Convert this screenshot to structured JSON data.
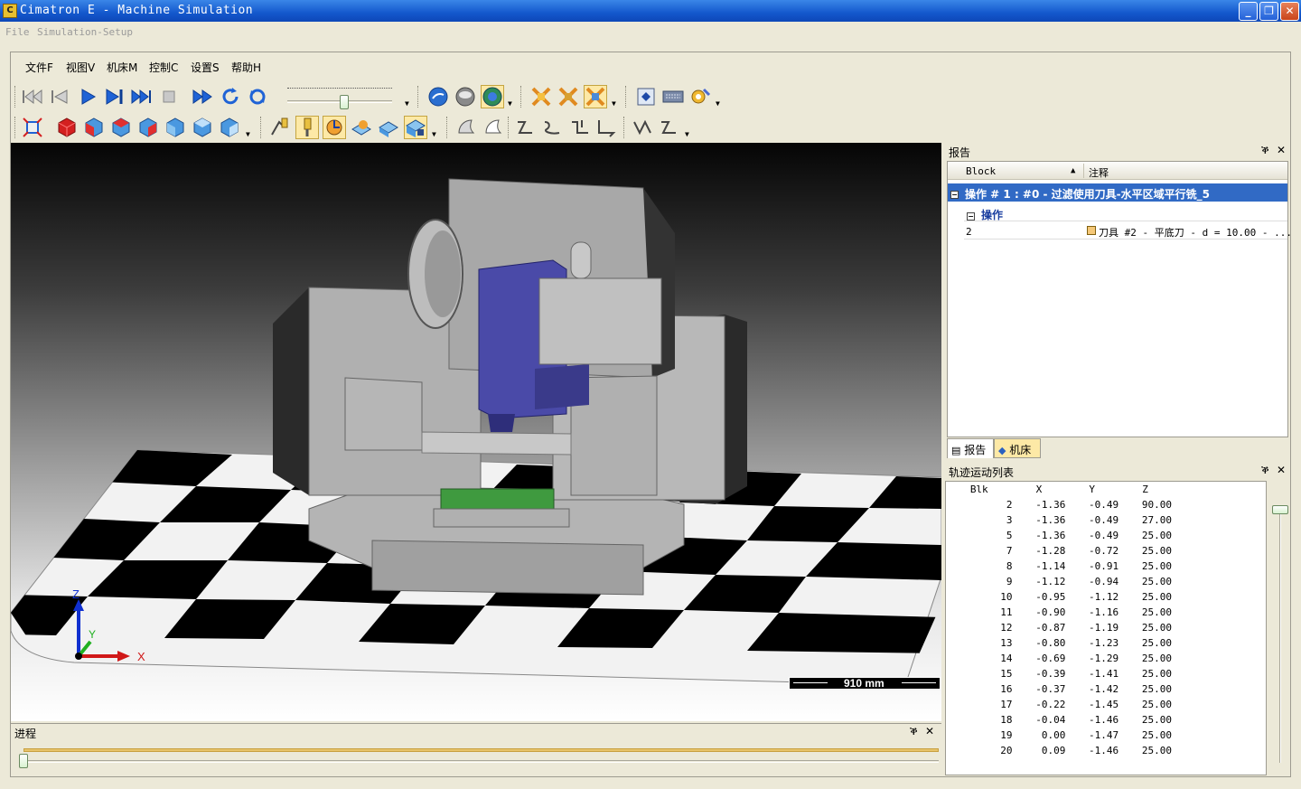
{
  "window": {
    "title": "Cimatron E - Machine Simulation",
    "minimize": "_",
    "maximize": "❐",
    "close": "✕"
  },
  "top_menu": [
    "File",
    "Simulation-Setup"
  ],
  "menu": [
    "文件F",
    "视图V",
    "机床M",
    "控制C",
    "设置S",
    "帮助H"
  ],
  "viewport": {
    "axis_x": "X",
    "axis_y": "Y",
    "axis_z": "Z",
    "scale_label": "910 mm",
    "colors": {
      "spindle": "#4a4aa8",
      "workpiece": "#3f9a3f",
      "machine": "#a8a8a8"
    }
  },
  "progress": {
    "title": "进程",
    "pin": "ቕ",
    "close": "✕",
    "value": 0.0
  },
  "report": {
    "title": "报告",
    "pin": "ቕ",
    "close": "✕",
    "col_block": "Block",
    "col_note": "注释",
    "op_row": "操作 # 1 : #0 - 过滤使用刀具-水平区域平行铣_5",
    "sub_row": "操作",
    "row_block": "2",
    "row_note": "刀具 #2 - 平底刀 - d = 10.00 - ...",
    "tab_report": "报告",
    "tab_machine": "机床"
  },
  "motion": {
    "title": "轨迹运动列表",
    "pin": "ቕ",
    "close": "✕",
    "headers": [
      "Blk",
      "X",
      "Y",
      "Z"
    ],
    "rows": [
      [
        "2",
        "-1.36",
        "-0.49",
        "90.00"
      ],
      [
        "3",
        "-1.36",
        "-0.49",
        "27.00"
      ],
      [
        "5",
        "-1.36",
        "-0.49",
        "25.00"
      ],
      [
        "7",
        "-1.28",
        "-0.72",
        "25.00"
      ],
      [
        "8",
        "-1.14",
        "-0.91",
        "25.00"
      ],
      [
        "9",
        "-1.12",
        "-0.94",
        "25.00"
      ],
      [
        "10",
        "-0.95",
        "-1.12",
        "25.00"
      ],
      [
        "11",
        "-0.90",
        "-1.16",
        "25.00"
      ],
      [
        "12",
        "-0.87",
        "-1.19",
        "25.00"
      ],
      [
        "13",
        "-0.80",
        "-1.23",
        "25.00"
      ],
      [
        "14",
        "-0.69",
        "-1.29",
        "25.00"
      ],
      [
        "15",
        "-0.39",
        "-1.41",
        "25.00"
      ],
      [
        "16",
        "-0.37",
        "-1.42",
        "25.00"
      ],
      [
        "17",
        "-0.22",
        "-1.45",
        "25.00"
      ],
      [
        "18",
        "-0.04",
        "-1.46",
        "25.00"
      ],
      [
        "19",
        "0.00",
        "-1.47",
        "25.00"
      ],
      [
        "20",
        "0.09",
        "-1.46",
        "25.00"
      ]
    ]
  },
  "toolbar_icons": {
    "row1": [
      "skip-to-start-icon",
      "step-back-icon",
      "play-icon",
      "step-forward-icon",
      "skip-to-end-icon",
      "stop-icon",
      "fast-forward-icon",
      "rewind-cycle-icon",
      "loop-icon",
      "speed-slider",
      "view-mode-icon",
      "sphere-icon",
      "globe-icon",
      "collision-icon",
      "collision-check-icon",
      "collision-highlight-icon",
      "machine-setup-icon",
      "keyboard-icon",
      "tools-settings-icon"
    ],
    "row2": [
      "fit-view-icon",
      "view-cube-red-icon",
      "view-cube-front-icon",
      "view-cube-top-icon",
      "view-cube-right-icon",
      "view-cube-left-icon",
      "view-cube-back-icon",
      "view-cube-iso-icon",
      "tool-path-icon",
      "tool-icon",
      "tool-holder-icon",
      "stock-icon",
      "part-icon",
      "machine-icon",
      "shade-icon",
      "wire-icon",
      "trace-1-icon",
      "trace-2-icon",
      "trace-3-icon",
      "trace-4-icon",
      "trace-5-icon",
      "trace-6-icon"
    ]
  }
}
